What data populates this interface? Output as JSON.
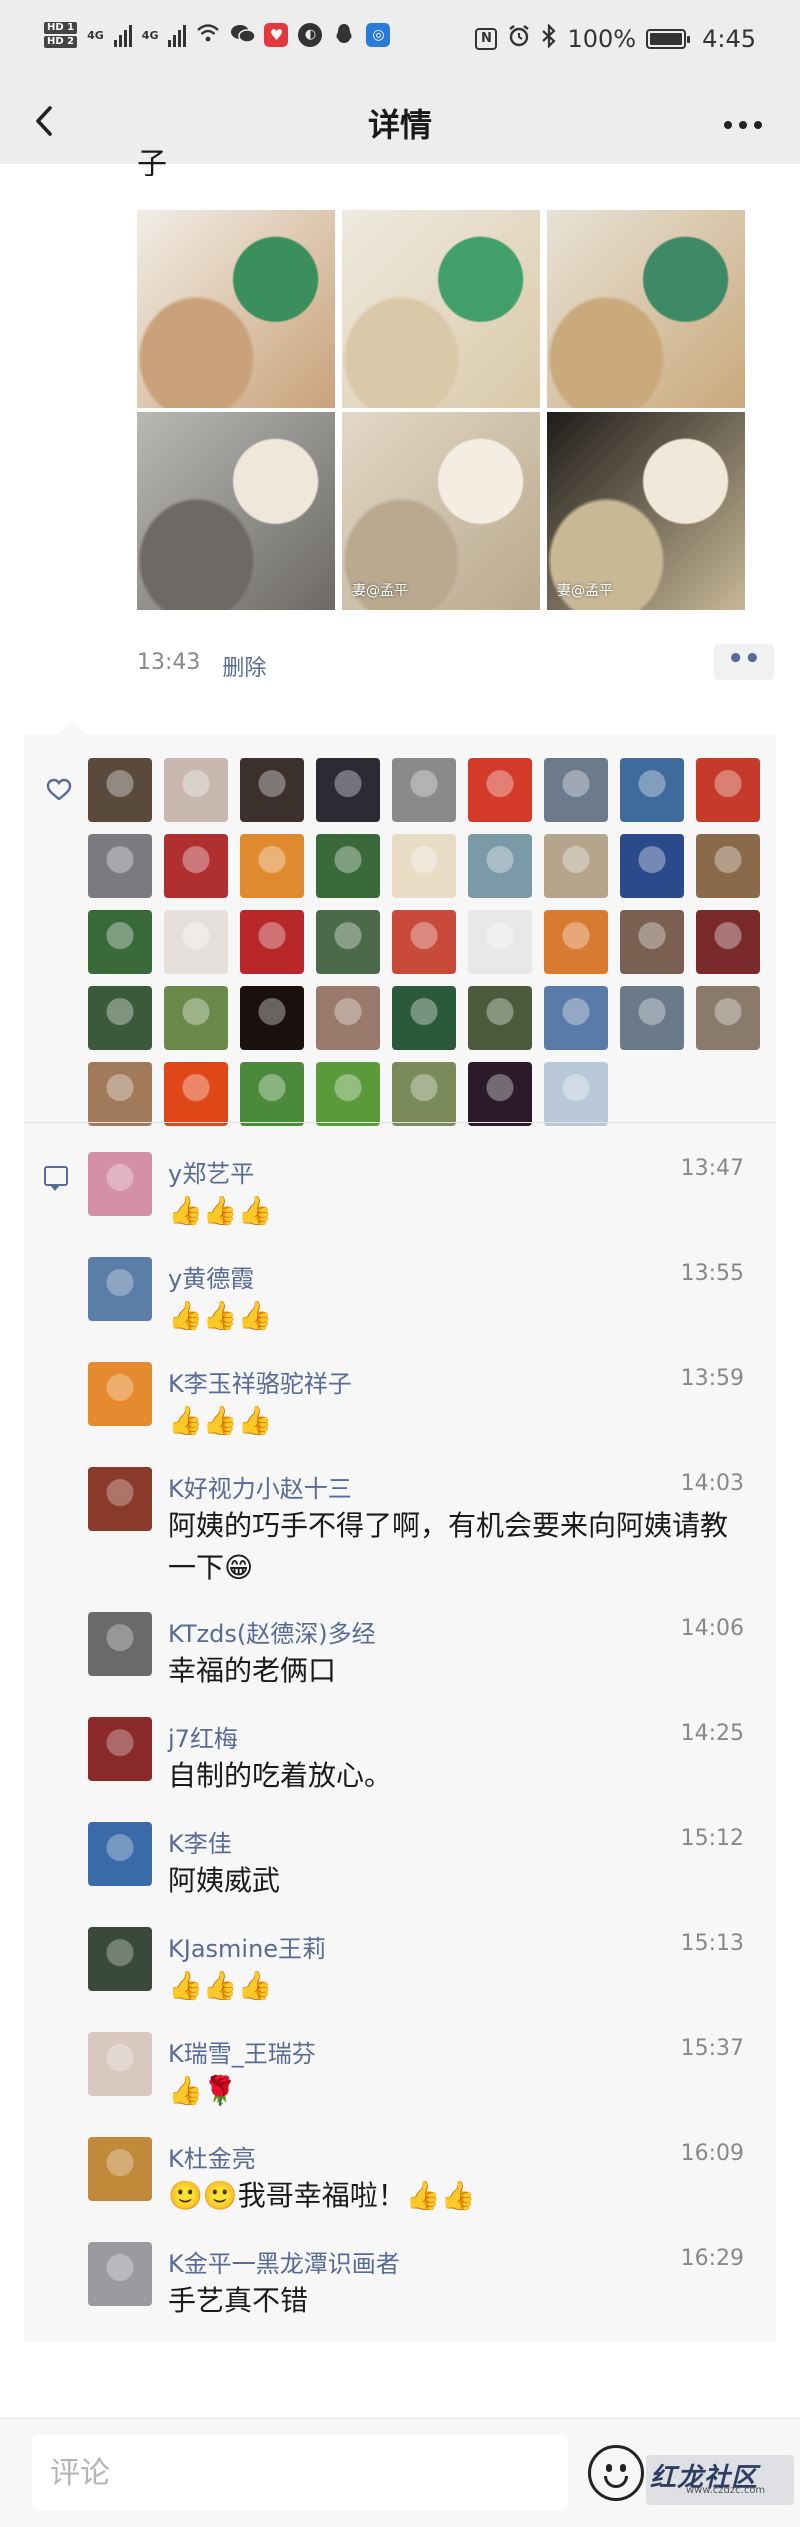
{
  "status_bar": {
    "hd1": "HD 1",
    "hd2": "HD 2",
    "net1": "4G",
    "net2": "4G",
    "battery": "100%",
    "time": "4:45"
  },
  "nav": {
    "title": "详情",
    "back_icon": "chevron-left-icon",
    "more_icon": "more-horizontal-icon"
  },
  "post": {
    "text_tail": "子",
    "photos": [
      {
        "watermark": "",
        "colors": [
          "#f1ede6",
          "#3a8f5c",
          "#c9a27a"
        ]
      },
      {
        "watermark": "",
        "colors": [
          "#efeae0",
          "#41a06a",
          "#d9c9a8"
        ]
      },
      {
        "watermark": "",
        "colors": [
          "#e7e2d6",
          "#3f8a66",
          "#caa97c"
        ]
      },
      {
        "watermark": "",
        "colors": [
          "#b8b8b4",
          "#efe7d9",
          "#6d6a66"
        ]
      },
      {
        "watermark": "妻@孟平",
        "colors": [
          "#e2d8c6",
          "#f4ede1",
          "#b9a98e"
        ]
      },
      {
        "watermark": "妻@孟平",
        "colors": [
          "#1e1c1a",
          "#f0e8d8",
          "#c8b896"
        ]
      }
    ],
    "time": "13:43",
    "delete_label": "删除",
    "more_label": "••"
  },
  "likes": {
    "icon": "heart-icon",
    "avatars": [
      "#5a4a3c",
      "#c8b8b0",
      "#3b302c",
      "#2d2a33",
      "#8a8a8a",
      "#d43a2a",
      "#6c7a8c",
      "#3e6a9c",
      "#c63a2a",
      "#7a7a80",
      "#b03030",
      "#e08a30",
      "#3a6a3a",
      "#e8dcc4",
      "#7a9aa8",
      "#b4a48c",
      "#2a4a8c",
      "#8a6a4a",
      "#3a6a3a",
      "#e6e0dc",
      "#b8282a",
      "#4a6a4a",
      "#c84a3a",
      "#e8e8e8",
      "#d87a30",
      "#7a6050",
      "#7a2a2a",
      "#3a5a3a",
      "#6a8a4a",
      "#1a1010",
      "#9a7a6a",
      "#2a5a3a",
      "#4a5a3a",
      "#5a7aa8",
      "#6a7a8a",
      "#8a7a6a",
      "#a07a5a",
      "#e0481a",
      "#4a8a3a",
      "#5a9a3a",
      "#7a8a5a",
      "#2a1a2a",
      "#b8c8d8"
    ]
  },
  "comments": {
    "icon": "comment-icon",
    "items": [
      {
        "name": "y郑艺平",
        "time": "13:47",
        "text": "👍👍👍",
        "avatar": "#d490a8"
      },
      {
        "name": "y黄德霞",
        "time": "13:55",
        "text": "👍👍👍",
        "avatar": "#5a7ea8"
      },
      {
        "name": "K李玉祥骆驼祥子",
        "time": "13:59",
        "text": "👍👍👍",
        "avatar": "#e58a2e"
      },
      {
        "name": "K好视力小赵十三",
        "time": "14:03",
        "text": "阿姨的巧手不得了啊，有机会要来向阿姨请教一下😁",
        "avatar": "#8a3a2a"
      },
      {
        "name": "KTzds(赵德深)多经",
        "time": "14:06",
        "text": "幸福的老俩口",
        "avatar": "#6a6a6a"
      },
      {
        "name": "j7红梅",
        "time": "14:25",
        "text": "自制的吃着放心。",
        "avatar": "#8a2a2a"
      },
      {
        "name": "K李佳",
        "time": "15:12",
        "text": "阿姨威武",
        "avatar": "#3a6aa8"
      },
      {
        "name": "KJasmine王莉",
        "time": "15:13",
        "text": "👍👍👍",
        "avatar": "#3a4a3a"
      },
      {
        "name": "K瑞雪_王瑞芬",
        "time": "15:37",
        "text": "👍🌹",
        "avatar": "#d8c8c0"
      },
      {
        "name": "K杜金亮",
        "time": "16:09",
        "text": "🙂🙂我哥幸福啦！👍👍",
        "avatar": "#c08a3a"
      },
      {
        "name": "K金平一黑龙潭识画者",
        "time": "16:29",
        "text": "手艺真不错",
        "avatar": "#9a9aa0"
      }
    ]
  },
  "input": {
    "placeholder": "评论",
    "emoji_icon": "emoji-smile-icon"
  },
  "watermark": {
    "text": "红龙社区",
    "url": "www.czdzc.com"
  }
}
